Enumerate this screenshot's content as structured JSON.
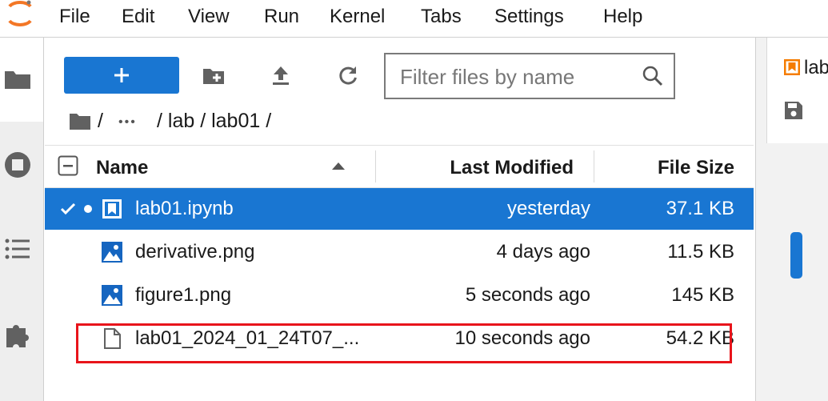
{
  "menubar": {
    "items": [
      "File",
      "Edit",
      "View",
      "Run",
      "Kernel",
      "Tabs",
      "Settings",
      "Help"
    ]
  },
  "sidebar": {
    "icons": [
      "folder-icon",
      "stop-circle-icon",
      "list-icon",
      "puzzle-piece-icon"
    ]
  },
  "toolbar": {
    "new_label": "+",
    "filter_placeholder": "Filter files by name"
  },
  "breadcrumb": {
    "root": "/",
    "ellipsis": "•••",
    "path": "/ lab / lab01 /"
  },
  "listing": {
    "columns": {
      "name": "Name",
      "modified": "Last Modified",
      "size": "File Size"
    },
    "sort_indicator": "ascending",
    "rows": [
      {
        "name": "lab01.ipynb",
        "modified": "yesterday",
        "size": "37.1 KB",
        "type": "notebook",
        "selected": true,
        "running": true
      },
      {
        "name": "derivative.png",
        "modified": "4 days ago",
        "size": "11.5 KB",
        "type": "image",
        "selected": false,
        "running": false
      },
      {
        "name": "figure1.png",
        "modified": "5 seconds ago",
        "size": "145 KB",
        "type": "image",
        "selected": false,
        "running": false
      },
      {
        "name": "lab01_2024_01_24T07_...",
        "modified": "10 seconds ago",
        "size": "54.2 KB",
        "type": "file",
        "selected": false,
        "running": false
      }
    ]
  },
  "right_panel": {
    "tab_label": "lab"
  },
  "colors": {
    "accent": "#1976d2",
    "highlight_box": "#e8141b",
    "notebook_icon": "#f57c00"
  }
}
